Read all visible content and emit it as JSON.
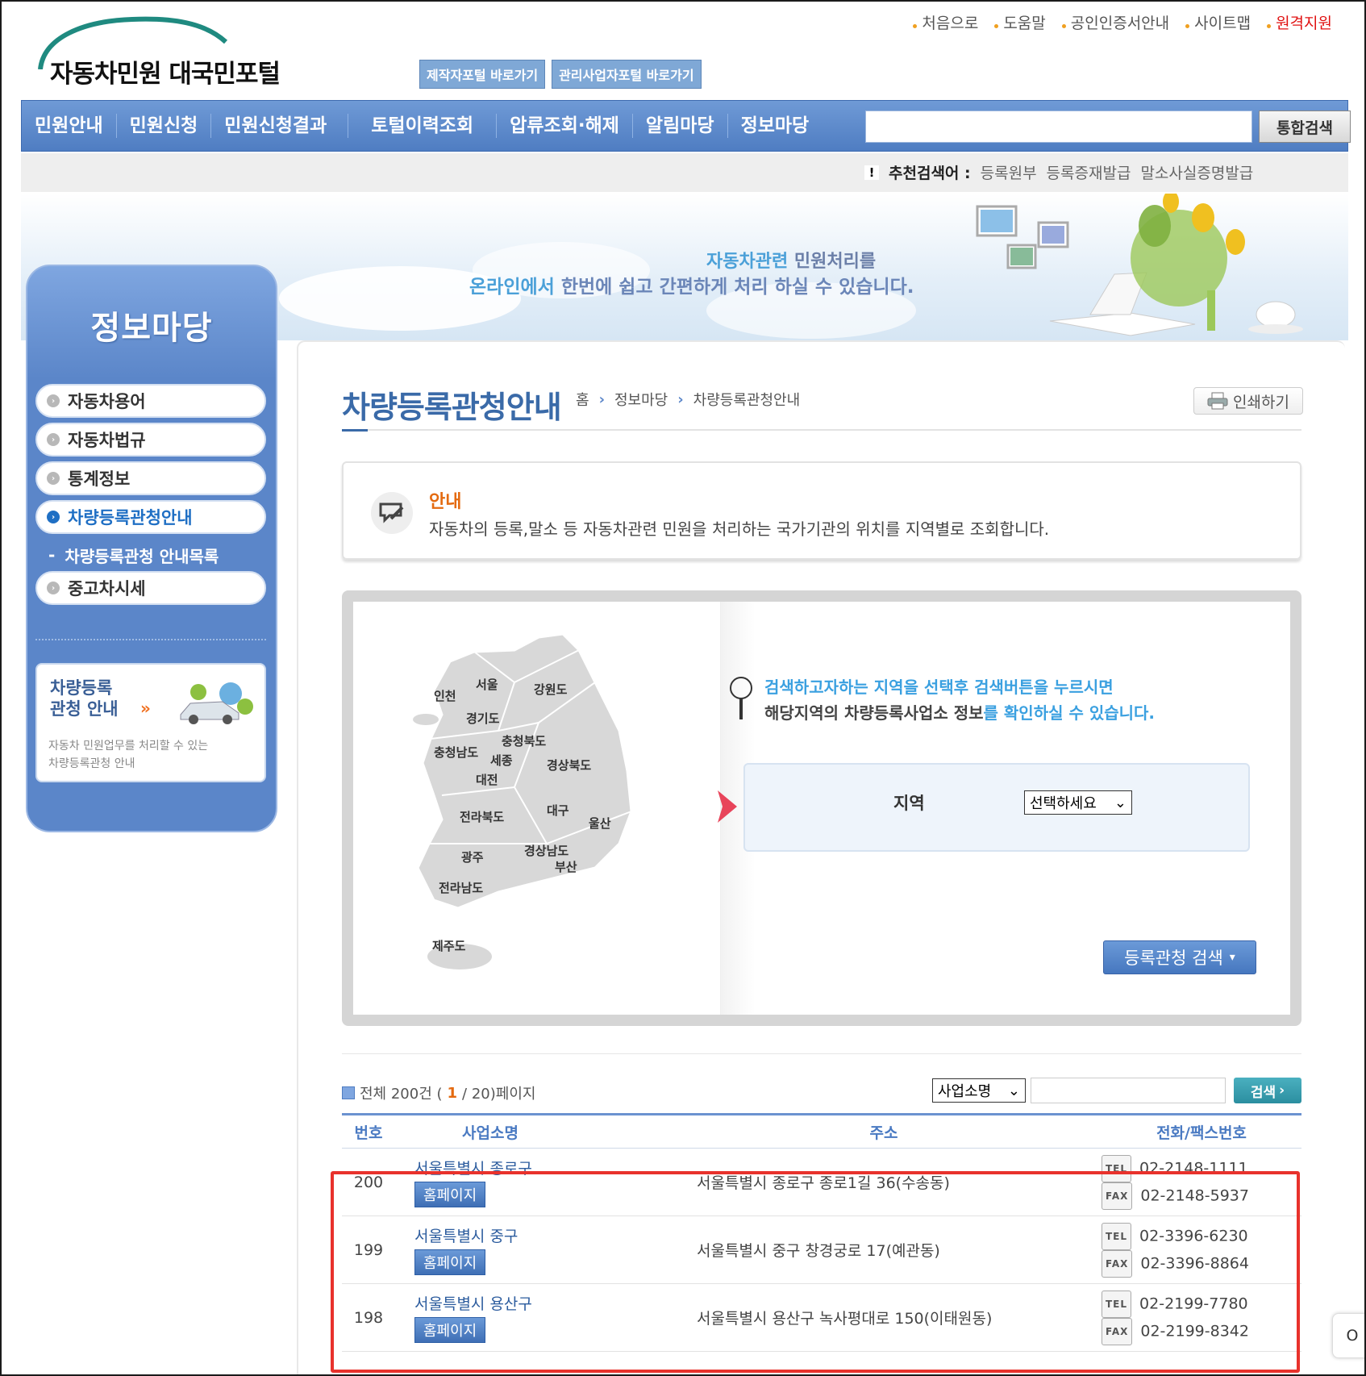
{
  "util_links": [
    {
      "label": "처음으로"
    },
    {
      "label": "도움말"
    },
    {
      "label": "공인인증서안내"
    },
    {
      "label": "사이트맵"
    },
    {
      "label": "원격지원",
      "color": "#e01010"
    }
  ],
  "logo": {
    "text": "자동차민원 대국민포털"
  },
  "shortcuts": [
    "제작자포털 바로가기",
    "관리사업자포털 바로가기"
  ],
  "gnb": {
    "menu": [
      "민원안내",
      "민원신청",
      "민원신청결과",
      "토털이력조회",
      "압류조회·해제",
      "알림마당",
      "정보마당"
    ],
    "search_button": "통합검색"
  },
  "recommend": {
    "label": "추천검색어 :",
    "keywords": [
      "등록원부",
      "등록증재발급",
      "말소사실증명발급"
    ]
  },
  "banner": {
    "line1_a": "자동차관련",
    "line1_b": " 민원처리를",
    "line2_a": "온라인에서",
    "line2_b": " 한번에 쉽고 간편하게 처리 하실 수 있습니다."
  },
  "lnb": {
    "title": "정보마당",
    "items": [
      {
        "label": "자동차용어"
      },
      {
        "label": "자동차법규"
      },
      {
        "label": "통계정보"
      },
      {
        "label": "차량등록관청안내",
        "active": true
      }
    ],
    "subitem": "차량등록관청 안내목록",
    "last_item": "중고차시세",
    "promo": {
      "title_line1": "차량등록",
      "title_line2": "관청 안내",
      "desc_line1": "자동차 민원업무를 처리할 수 있는",
      "desc_line2": "차량등록관청 안내"
    }
  },
  "page": {
    "title": "차량등록관청안내",
    "breadcrumb": [
      "홈",
      "정보마당",
      "차량등록관청안내"
    ],
    "print_label": "인쇄하기"
  },
  "notice": {
    "title": "안내",
    "text": "자동차의 등록,말소 등 자동차관련 민원을 처리하는 국가기관의 위치를 지역별로 조회합니다."
  },
  "map": {
    "regions": [
      "서울",
      "인천",
      "강원도",
      "경기도",
      "충청북도",
      "충청남도",
      "세종",
      "경상북도",
      "대전",
      "전라북도",
      "대구",
      "울산",
      "광주",
      "경상남도",
      "부산",
      "전라남도",
      "제주도"
    ],
    "hint_line1": "검색하고자하는 지역을 선택후 검색버튼을 누르시면",
    "hint_line2_bold": "해당지역의 차량등록사업소 정보",
    "hint_line2_rest": "를 확인하실 수 있습니다.",
    "region_label": "지역",
    "region_select": "선택하세요",
    "search_button": "등록관청 검색"
  },
  "list": {
    "total_prefix": "전체 200건 (",
    "current_page": "1",
    "total_suffix": " / 20)페이지",
    "search_select": "사업소명",
    "search_button": "검색",
    "headers": [
      "번호",
      "사업소명",
      "주소",
      "전화/팩스번호"
    ],
    "homepage_label": "홈페이지",
    "rows": [
      {
        "no": "200",
        "name": "서울특별시 종로구",
        "address": "서울특별시 종로구 종로1길 36(수송동)",
        "tel": "02-2148-1111",
        "fax": "02-2148-5937"
      },
      {
        "no": "199",
        "name": "서울특별시 중구",
        "address": "서울특별시 중구 창경궁로 17(예관동)",
        "tel": "02-3396-6230",
        "fax": "02-3396-8864"
      },
      {
        "no": "198",
        "name": "서울특별시 용산구",
        "address": "서울특별시 용산구 녹사평대로 150(이태원동)",
        "tel": "02-2199-7780",
        "fax": "02-2199-8342"
      }
    ],
    "tel_tag": "TEL",
    "fax_tag": "FAX"
  },
  "side_tab": "O"
}
